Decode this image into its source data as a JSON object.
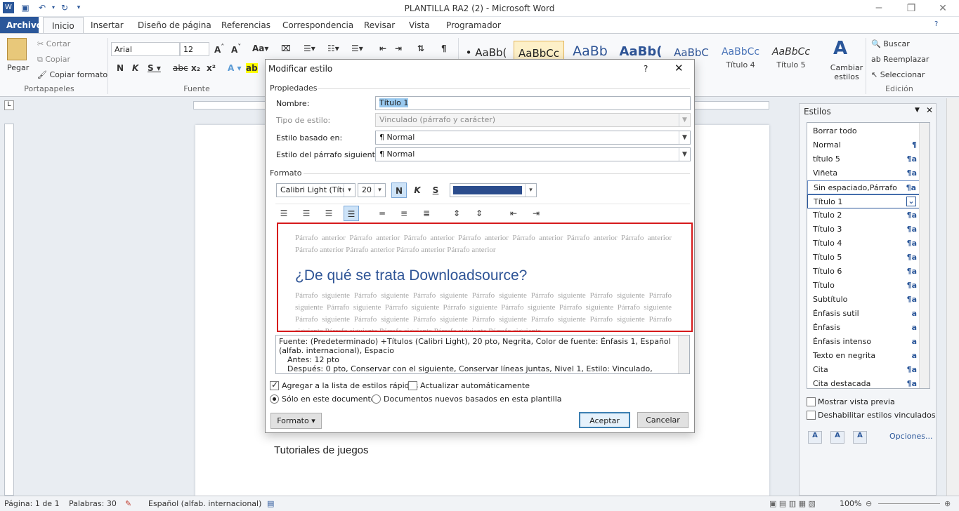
{
  "window": {
    "title": "PLANTILLA RA2 (2)  -  Microsoft Word"
  },
  "tabs": [
    {
      "label": "Archivo"
    },
    {
      "label": "Inicio"
    },
    {
      "label": "Insertar"
    },
    {
      "label": "Diseño de página"
    },
    {
      "label": "Referencias"
    },
    {
      "label": "Correspondencia"
    },
    {
      "label": "Revisar"
    },
    {
      "label": "Vista"
    },
    {
      "label": "Programador"
    }
  ],
  "ribbon": {
    "clipboard": {
      "paste": "Pegar",
      "cut": "Cortar",
      "copy": "Copiar",
      "format_painter": "Copiar formato",
      "label": "Portapapeles"
    },
    "font": {
      "name": "Arial",
      "size": "12",
      "label": "Fuente"
    },
    "styles_gallery": [
      {
        "sample": "• AaBb(",
        "name": ""
      },
      {
        "sample": "AaBbCc",
        "name": ""
      },
      {
        "sample": "AaBb",
        "name": ""
      },
      {
        "sample": "AaBb(",
        "name": ""
      },
      {
        "sample": "AaBbC",
        "name": "3"
      },
      {
        "sample": "AaBbCc",
        "name": "Título 4"
      },
      {
        "sample": "AaBbCc",
        "name": "Título 5"
      }
    ],
    "change_styles": "Cambiar estilos",
    "editing": {
      "find": "Buscar",
      "replace": "Reemplazar",
      "select": "Seleccionar",
      "label": "Edición"
    }
  },
  "dialog": {
    "title": "Modificar estilo",
    "help": "?",
    "section_props": "Propiedades",
    "name_label": "Nombre:",
    "name_value": "Título 1",
    "type_label": "Tipo de estilo:",
    "type_value": "Vinculado (párrafo y carácter)",
    "based_label": "Estilo basado en:",
    "based_value": "¶  Normal",
    "next_label": "Estilo del párrafo siguiente:",
    "next_value": "¶  Normal",
    "section_format": "Formato",
    "font_value": "Calibri Light (Títulos",
    "size_value": "20",
    "color_value": "#2b4c8c",
    "preview_before": "Párrafo anterior Párrafo anterior Párrafo anterior Párrafo anterior Párrafo anterior Párrafo anterior Párrafo anterior Párrafo anterior Párrafo anterior Párrafo anterior Párrafo anterior",
    "preview_title": "¿De qué se trata Downloadsource?",
    "preview_after": "Párrafo siguiente Párrafo siguiente Párrafo siguiente Párrafo siguiente Párrafo siguiente Párrafo siguiente Párrafo siguiente Párrafo siguiente Párrafo siguiente Párrafo siguiente Párrafo siguiente Párrafo siguiente Párrafo siguiente Párrafo siguiente Párrafo siguiente Párrafo siguiente Párrafo siguiente Párrafo siguiente Párrafo siguiente Párrafo siguiente Párrafo siguiente Párrafo siguiente Párrafo siguiente Párrafo siguiente",
    "description_1": "Fuente: (Predeterminado) +Títulos (Calibri Light), 20 pto, Negrita, Color de fuente: Énfasis 1, Español (alfab. internacional), Espacio",
    "description_2": "Antes:  12 pto",
    "description_3": "Después:  0 pto, Conservar con el siguiente, Conservar líneas juntas, Nivel 1, Estilo: Vinculado, Estilo rápido,",
    "add_quick": "Agregar a la lista de estilos rápidos",
    "auto_update": "Actualizar automáticamente",
    "only_doc": "Sólo en este documento",
    "new_docs": "Documentos nuevos basados en esta plantilla",
    "format_btn": "Formato ▾",
    "ok": "Aceptar",
    "cancel": "Cancelar"
  },
  "document": {
    "visible_text": "Tutoriales de juegos"
  },
  "styles_pane": {
    "title": "Estilos",
    "items": [
      {
        "label": "Borrar todo",
        "icon": ""
      },
      {
        "label": "Normal",
        "icon": "¶"
      },
      {
        "label": "título 5",
        "icon": "¶a"
      },
      {
        "label": "Viñeta",
        "icon": "¶a"
      },
      {
        "label": "Sin espaciado,Párrafo",
        "icon": "¶a"
      },
      {
        "label": "Título 1",
        "icon": "⌄"
      },
      {
        "label": "Título 2",
        "icon": "¶a"
      },
      {
        "label": "Título 3",
        "icon": "¶a"
      },
      {
        "label": "Título 4",
        "icon": "¶a"
      },
      {
        "label": "Título 5",
        "icon": "¶a"
      },
      {
        "label": "Título 6",
        "icon": "¶a"
      },
      {
        "label": "Título",
        "icon": "¶a"
      },
      {
        "label": "Subtítulo",
        "icon": "¶a"
      },
      {
        "label": "Énfasis sutil",
        "icon": "a"
      },
      {
        "label": "Énfasis",
        "icon": "a"
      },
      {
        "label": "Énfasis intenso",
        "icon": "a"
      },
      {
        "label": "Texto en negrita",
        "icon": "a"
      },
      {
        "label": "Cita",
        "icon": "¶a"
      },
      {
        "label": "Cita destacada",
        "icon": "¶a"
      }
    ],
    "show_preview": "Mostrar vista previa",
    "disable_linked": "Deshabilitar estilos vinculados",
    "options": "Opciones..."
  },
  "status": {
    "page": "Página: 1 de 1",
    "words": "Palabras: 30",
    "language": "Español (alfab. internacional)",
    "zoom": "100%"
  }
}
